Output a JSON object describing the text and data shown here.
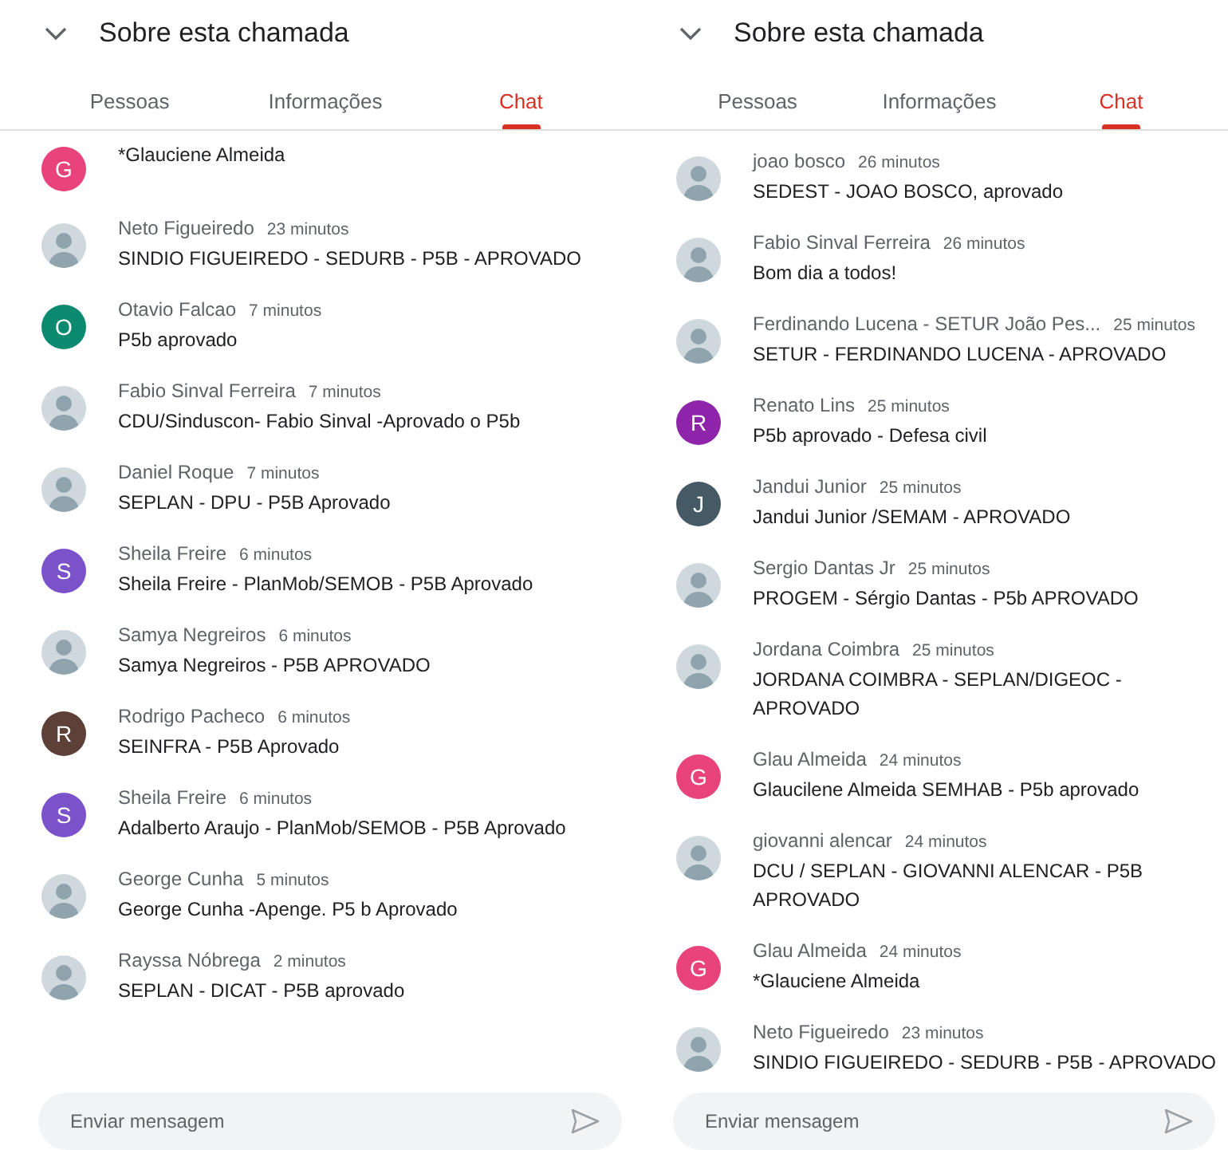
{
  "panels": [
    {
      "title": "Sobre esta chamada",
      "tabs": [
        {
          "label": "Pessoas",
          "selected": false
        },
        {
          "label": "Informações",
          "selected": false
        },
        {
          "label": "Chat",
          "selected": true
        }
      ],
      "messages": [
        {
          "text": "*Glauciene Almeida",
          "avatar": {
            "kind": "letter",
            "letter": "G",
            "color": "#e8437b"
          }
        },
        {
          "sender": "Neto Figueiredo",
          "time": "23 minutos",
          "text": "SINDIO FIGUEIREDO - SEDURB - P5B - APROVADO",
          "avatar": {
            "kind": "photo"
          }
        },
        {
          "sender": "Otavio Falcao",
          "time": "7 minutos",
          "text": "P5b aprovado",
          "avatar": {
            "kind": "letter",
            "letter": "O",
            "color": "#0b8a6f"
          }
        },
        {
          "sender": "Fabio Sinval Ferreira",
          "time": "7 minutos",
          "text": "CDU/Sinduscon- Fabio Sinval -Aprovado o P5b",
          "avatar": {
            "kind": "photo"
          }
        },
        {
          "sender": "Daniel Roque",
          "time": "7 minutos",
          "text": "SEPLAN - DPU - P5B Aprovado",
          "avatar": {
            "kind": "photo"
          }
        },
        {
          "sender": "Sheila Freire",
          "time": "6 minutos",
          "text": "Sheila Freire - PlanMob/SEMOB - P5B Aprovado",
          "avatar": {
            "kind": "letter",
            "letter": "S",
            "color": "#7b52c9"
          }
        },
        {
          "sender": "Samya Negreiros",
          "time": "6 minutos",
          "text": "Samya Negreiros - P5B APROVADO",
          "avatar": {
            "kind": "photo"
          }
        },
        {
          "sender": "Rodrigo Pacheco",
          "time": "6 minutos",
          "text": "SEINFRA - P5B Aprovado",
          "avatar": {
            "kind": "letter",
            "letter": "R",
            "color": "#5d4037"
          }
        },
        {
          "sender": "Sheila Freire",
          "time": "6 minutos",
          "text": "Adalberto Araujo - PlanMob/SEMOB - P5B Aprovado",
          "avatar": {
            "kind": "letter",
            "letter": "S",
            "color": "#7b52c9"
          }
        },
        {
          "sender": "George Cunha",
          "time": "5 minutos",
          "text": "George Cunha -Apenge. P5 b Aprovado",
          "avatar": {
            "kind": "photo"
          }
        },
        {
          "sender": "Rayssa Nóbrega",
          "time": "2 minutos",
          "text": "SEPLAN - DICAT - P5B aprovado",
          "avatar": {
            "kind": "photo"
          }
        }
      ],
      "input": {
        "placeholder": "Enviar mensagem"
      }
    },
    {
      "title": "Sobre esta chamada",
      "tabs": [
        {
          "label": "Pessoas",
          "selected": false
        },
        {
          "label": "Informações",
          "selected": false
        },
        {
          "label": "Chat",
          "selected": true
        }
      ],
      "messages": [
        {
          "sender": "joao bosco",
          "time": "26 minutos",
          "text": "SEDEST - JOAO BOSCO, aprovado",
          "avatar": {
            "kind": "photo"
          }
        },
        {
          "sender": "Fabio Sinval Ferreira",
          "time": "26 minutos",
          "text": "Bom dia a todos!",
          "avatar": {
            "kind": "photo"
          }
        },
        {
          "sender": "Ferdinando Lucena - SETUR João Pes...",
          "time": "25 minutos",
          "text": "SETUR - FERDINANDO LUCENA - APROVADO",
          "avatar": {
            "kind": "photo"
          }
        },
        {
          "sender": "Renato Lins",
          "time": "25 minutos",
          "text": "P5b aprovado - Defesa civil",
          "avatar": {
            "kind": "letter",
            "letter": "R",
            "color": "#8e24aa"
          }
        },
        {
          "sender": "Jandui Junior",
          "time": "25 minutos",
          "text": "Jandui Junior /SEMAM - APROVADO",
          "avatar": {
            "kind": "letter",
            "letter": "J",
            "color": "#455a64"
          }
        },
        {
          "sender": "Sergio Dantas Jr",
          "time": "25 minutos",
          "text": "PROGEM - Sérgio Dantas - P5b APROVADO",
          "avatar": {
            "kind": "photo"
          }
        },
        {
          "sender": "Jordana Coimbra",
          "time": "25 minutos",
          "text": "JORDANA COIMBRA - SEPLAN/DIGEOC - APROVADO",
          "avatar": {
            "kind": "photo"
          }
        },
        {
          "sender": "Glau Almeida",
          "time": "24 minutos",
          "text": "Glaucilene Almeida SEMHAB - P5b aprovado",
          "avatar": {
            "kind": "letter",
            "letter": "G",
            "color": "#e8437b"
          }
        },
        {
          "sender": "giovanni alencar",
          "time": "24 minutos",
          "text": "DCU / SEPLAN - GIOVANNI ALENCAR - P5B APROVADO",
          "avatar": {
            "kind": "photo"
          }
        },
        {
          "sender": "Glau Almeida",
          "time": "24 minutos",
          "text": "*Glauciene Almeida",
          "avatar": {
            "kind": "letter",
            "letter": "G",
            "color": "#e8437b"
          }
        },
        {
          "sender": "Neto Figueiredo",
          "time": "23 minutos",
          "text": "SINDIO FIGUEIREDO - SEDURB - P5B - APROVADO",
          "avatar": {
            "kind": "photo"
          }
        }
      ],
      "input": {
        "placeholder": "Enviar mensagem"
      }
    }
  ]
}
